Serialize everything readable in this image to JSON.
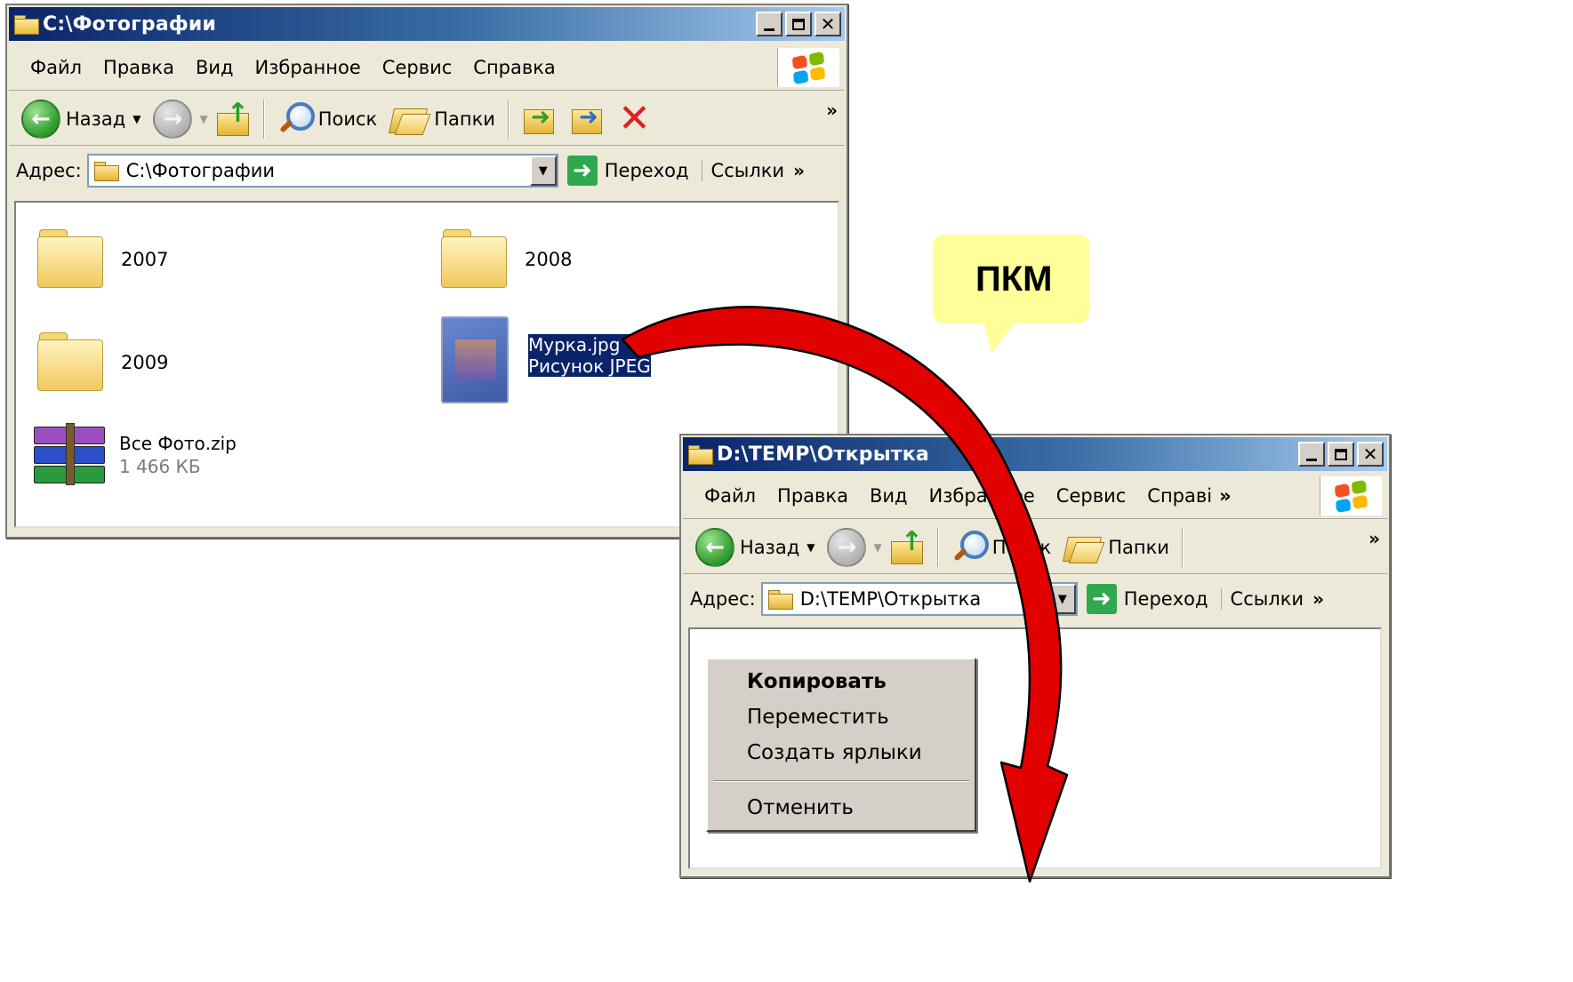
{
  "window1": {
    "title": "C:\\Фотографии",
    "menu": [
      "Файл",
      "Правка",
      "Вид",
      "Избранное",
      "Сервис",
      "Справка"
    ],
    "toolbar": {
      "back": "Назад",
      "search": "Поиск",
      "folders": "Папки"
    },
    "address": {
      "label": "Адрес:",
      "value": "C:\\Фотографии",
      "go": "Переход",
      "links": "Ссылки"
    },
    "items": [
      {
        "name": "2007"
      },
      {
        "name": "2008"
      },
      {
        "name": "2009"
      },
      {
        "name": "Мурка.jpg",
        "type": "Рисунок JPEG"
      },
      {
        "name": "Все Фото.zip",
        "size": "1 466 КБ"
      }
    ]
  },
  "window2": {
    "title": "D:\\TEMP\\Открытка",
    "menu": [
      "Файл",
      "Правка",
      "Вид",
      "Избранное",
      "Сервис",
      "Справі"
    ],
    "toolbar": {
      "back": "Назад",
      "search": "Поиск",
      "folders": "Папки"
    },
    "address": {
      "label": "Адрес:",
      "value": "D:\\TEMP\\Открытка",
      "go": "Переход",
      "links": "Ссылки"
    }
  },
  "context_menu": {
    "items": [
      "Копировать",
      "Переместить",
      "Создать ярлыки",
      "Отменить"
    ]
  },
  "callout": {
    "text": "ПКМ"
  },
  "colors": {
    "titlebar_start": "#0a246a",
    "titlebar_end": "#a6caf0",
    "selection": "#0a246a",
    "arrow": "#e00000",
    "callout": "#ffff99"
  },
  "icons": {
    "window": [
      "folder-icon",
      "minimize-icon",
      "maximize-icon",
      "close-icon",
      "windows-flag-icon"
    ],
    "toolbar": [
      "back-arrow-icon",
      "forward-arrow-icon",
      "folder-up-icon",
      "search-icon",
      "folders-icon",
      "move-to-icon",
      "copy-to-icon",
      "delete-icon"
    ],
    "files": [
      "folder-icon",
      "jpeg-file-icon",
      "winrar-archive-icon"
    ],
    "overlay": [
      "curved-arrow-icon",
      "speech-callout"
    ]
  }
}
